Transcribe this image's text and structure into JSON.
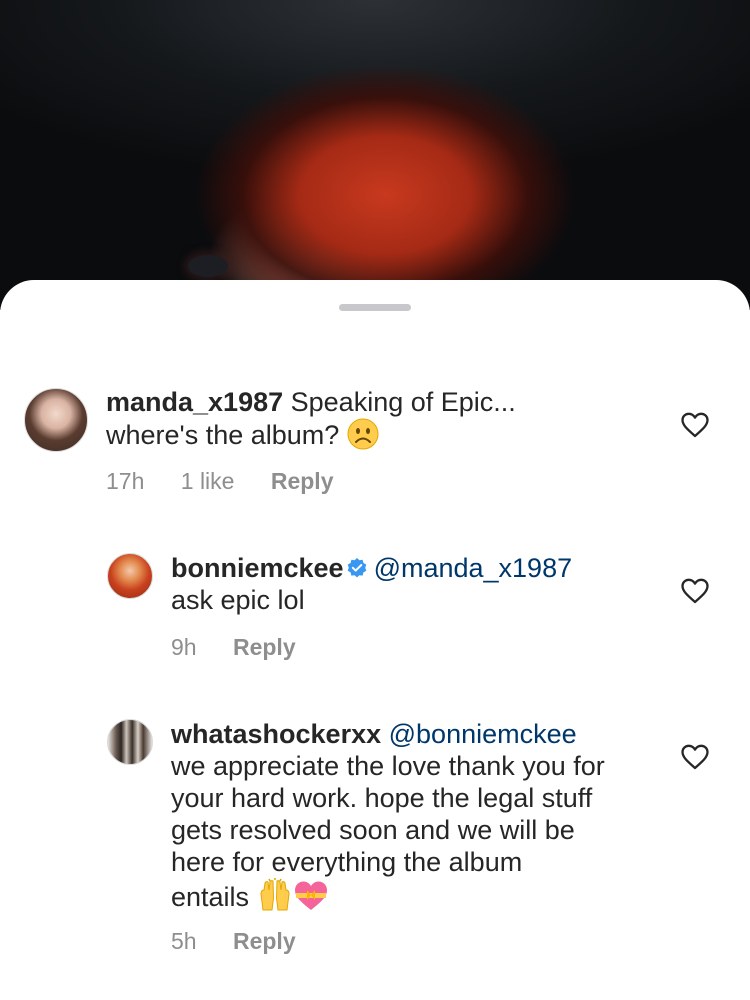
{
  "comments": [
    {
      "username": "manda_x1987",
      "verified": false,
      "mention": "",
      "text_line1": "Speaking of Epic...",
      "text_line2": "where's the album?",
      "emoji": "sad-face",
      "time": "17h",
      "likes": "1 like",
      "reply": "Reply"
    },
    {
      "username": "bonniemckee",
      "verified": true,
      "mention": "@manda_x1987",
      "text": "ask epic lol",
      "time": "9h",
      "reply": "Reply"
    },
    {
      "username": "whatashockerxx",
      "verified": false,
      "mention": "@bonniemckee",
      "lines": [
        "we appreciate the love thank you for",
        "your hard work. hope the legal stuff",
        "gets resolved soon and we will be",
        "here for everything the album",
        "entails"
      ],
      "emojis": [
        "raising-hands",
        "heart-with-ribbon"
      ],
      "time": "5h",
      "reply": "Reply"
    }
  ],
  "colors": {
    "text": "#262626",
    "meta": "#8e8e8e",
    "mention": "#00376b",
    "verified": "#3897f0",
    "grabber": "#c7c7cc"
  }
}
